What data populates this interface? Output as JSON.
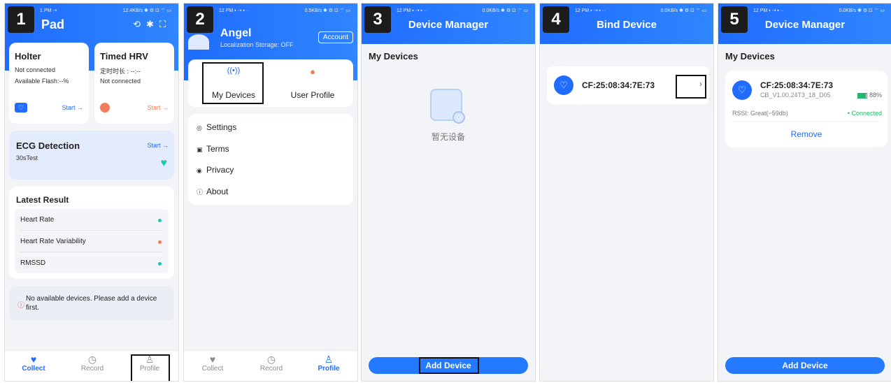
{
  "steps": [
    "1",
    "2",
    "3",
    "4",
    "5"
  ],
  "status_bar": {
    "s1_time": "1 PM ⇢",
    "s1_right": "12.4KB/s ✱ ⚙ ⊡ ⌔ ▭",
    "s2_time": "12 PM ▪ ⇢ ▪ ··",
    "s2_right": "0.5KB/s ✱ ⚙ ⊡ ⌔ ▭",
    "s3_time": "12 PM ▪ ⇢ ▪ ··",
    "s3_right": "0.0KB/s ✱ ⚙ ⊡ ⌔ ▭",
    "s4_time": "12 PM ▪ ⇢ ▪ ··",
    "s4_right": "0.0KB/s ✱ ⚙ ⊡ ⌔ ▭",
    "s5_time": "12 PM ▪ ⇢ ▪ ··",
    "s5_right": "0.0KB/s ✱ ⚙ ⊡ ⌔ ▭"
  },
  "screen1": {
    "title": "Pad",
    "holter": {
      "title": "Holter",
      "status": "Not connected",
      "flash": "Available Flash:--%",
      "start": "Start →"
    },
    "hrv": {
      "title": "Timed HRV",
      "timer": "定时时长 : --:--",
      "status": "Not connected",
      "start": "Start →"
    },
    "ecg": {
      "title": "ECG Detection",
      "sub": "30sTest",
      "start": "Start →"
    },
    "latest": {
      "title": "Latest Result",
      "rows": [
        {
          "label": "Heart Rate",
          "color": "#1ec8b4"
        },
        {
          "label": "Heart Rate Variability",
          "color": "#f57c5b"
        },
        {
          "label": "RMSSD",
          "color": "#1ec8b4"
        }
      ]
    },
    "notice": "No available devices. Please add a device first."
  },
  "tabs": {
    "collect": "Collect",
    "record": "Record",
    "profile": "Profile"
  },
  "screen2": {
    "name": "Angel",
    "storage": "Localization Storage: OFF",
    "account": "Account",
    "my_devices": "My Devices",
    "user_profile": "User Profile",
    "menu": [
      "Settings",
      "Terms",
      "Privacy",
      "About"
    ]
  },
  "screen3": {
    "title": "Device Manager",
    "section": "My Devices",
    "empty": "暂无设备",
    "add": "Add Device"
  },
  "screen4": {
    "title": "Bind Device",
    "device": "CF:25:08:34:7E:73"
  },
  "screen5": {
    "title": "Device Manager",
    "section": "My Devices",
    "device": "CF:25:08:34:7E:73",
    "firmware": "CB_V1.00.24T3_18_D05",
    "battery": "88%",
    "rssi": "RSSI: Great(−59db)",
    "connected": "• Connected",
    "remove": "Remove",
    "add": "Add Device"
  },
  "colors": {
    "primary": "#1f6cff",
    "teal": "#1ec8b4",
    "coral": "#f57c5b",
    "green": "#1fb86a"
  }
}
